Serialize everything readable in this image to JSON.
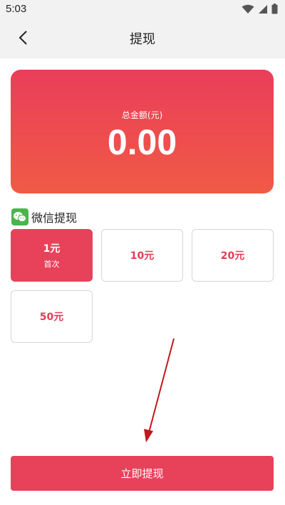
{
  "status_bar": {
    "time": "5:03"
  },
  "nav": {
    "title": "提现"
  },
  "balance": {
    "label": "总金额(元)",
    "value": "0.00"
  },
  "withdraw_method": {
    "label": "微信提现"
  },
  "amount_options": [
    {
      "amount": "1元",
      "tag": "首次",
      "selected": true
    },
    {
      "amount": "10元",
      "selected": false
    },
    {
      "amount": "20元",
      "selected": false
    },
    {
      "amount": "50元",
      "selected": false
    }
  ],
  "submit_button": {
    "label": "立即提现"
  },
  "colors": {
    "accent": "#e8425b",
    "card_gradient_start": "#ea3e5a",
    "card_gradient_end": "#f05a45",
    "wechat_green": "#4cb44d",
    "annotation_arrow": "#c4161c"
  },
  "icons": {
    "back": "chevron-left-icon",
    "wifi": "wifi-icon",
    "signal": "signal-icon",
    "battery": "battery-icon",
    "wechat": "wechat-icon"
  }
}
